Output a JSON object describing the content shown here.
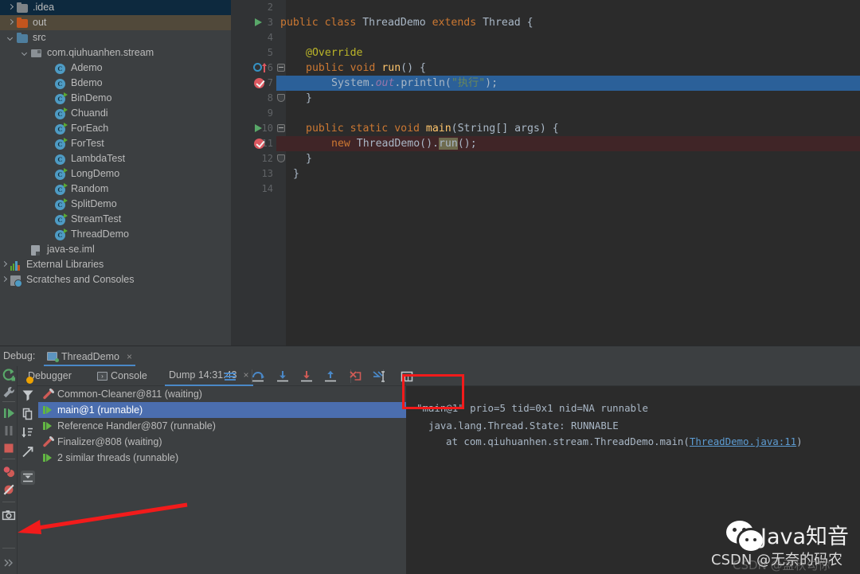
{
  "project_tree": {
    "items": [
      {
        "label": ".idea",
        "icon": "folder-gray-icon",
        "indent": 8,
        "twisty": "right",
        "state": "selected"
      },
      {
        "label": "out",
        "icon": "folder-orange-icon",
        "indent": 8,
        "twisty": "right",
        "state": "hover"
      },
      {
        "label": "src",
        "icon": "folder-blue-icon",
        "indent": 8,
        "twisty": "down",
        "state": "none"
      },
      {
        "label": "com.qiuhuanhen.stream",
        "icon": "package-icon",
        "indent": 26,
        "twisty": "down",
        "state": "none"
      },
      {
        "label": "Ademo",
        "icon": "java-class-icon",
        "indent": 56,
        "twisty": "none",
        "state": "none"
      },
      {
        "label": "Bdemo",
        "icon": "java-class-icon",
        "indent": 56,
        "twisty": "none",
        "state": "none"
      },
      {
        "label": "BinDemo",
        "icon": "java-class-runnable-icon",
        "indent": 56,
        "twisty": "none",
        "state": "none"
      },
      {
        "label": "Chuandi",
        "icon": "java-class-runnable-icon",
        "indent": 56,
        "twisty": "none",
        "state": "none"
      },
      {
        "label": "ForEach",
        "icon": "java-class-runnable-icon",
        "indent": 56,
        "twisty": "none",
        "state": "none"
      },
      {
        "label": "ForTest",
        "icon": "java-class-runnable-icon",
        "indent": 56,
        "twisty": "none",
        "state": "none"
      },
      {
        "label": "LambdaTest",
        "icon": "java-class-icon",
        "indent": 56,
        "twisty": "none",
        "state": "none"
      },
      {
        "label": "LongDemo",
        "icon": "java-class-runnable-icon",
        "indent": 56,
        "twisty": "none",
        "state": "none"
      },
      {
        "label": "Random",
        "icon": "java-class-runnable-icon",
        "indent": 56,
        "twisty": "none",
        "state": "none"
      },
      {
        "label": "SplitDemo",
        "icon": "java-class-runnable-icon",
        "indent": 56,
        "twisty": "none",
        "state": "none"
      },
      {
        "label": "StreamTest",
        "icon": "java-class-runnable-icon",
        "indent": 56,
        "twisty": "none",
        "state": "none"
      },
      {
        "label": "ThreadDemo",
        "icon": "java-class-runnable-icon",
        "indent": 56,
        "twisty": "none",
        "state": "none"
      },
      {
        "label": "java-se.iml",
        "icon": "iml-file-icon",
        "indent": 26,
        "twisty": "none",
        "state": "none"
      },
      {
        "label": "External Libraries",
        "icon": "external-libraries-icon",
        "indent": 0,
        "twisty": "right",
        "state": "none"
      },
      {
        "label": "Scratches and Consoles",
        "icon": "scratches-icon",
        "indent": 0,
        "twisty": "right",
        "state": "none"
      }
    ]
  },
  "editor": {
    "lines": [
      {
        "num": "2",
        "text": ""
      },
      {
        "num": "3",
        "text": "public class ThreadDemo extends Thread {"
      },
      {
        "num": "4",
        "text": ""
      },
      {
        "num": "5",
        "text": "    @Override"
      },
      {
        "num": "6",
        "text": "    public void run() {"
      },
      {
        "num": "7",
        "text": "        System.out.println(\"执行\");"
      },
      {
        "num": "8",
        "text": "    }"
      },
      {
        "num": "9",
        "text": ""
      },
      {
        "num": "10",
        "text": "    public static void main(String[] args) {"
      },
      {
        "num": "11",
        "text": "        new ThreadDemo().run();"
      },
      {
        "num": "12",
        "text": "    }"
      },
      {
        "num": "13",
        "text": "}"
      },
      {
        "num": "14",
        "text": ""
      }
    ],
    "tokens": {
      "l3_kw1": "public",
      "l3_kw2": "class",
      "l3_name": " ThreadDemo ",
      "l3_kw3": "extends",
      "l3_rest": " Thread {",
      "l5_annotation": "@Override",
      "l6_kw1": "public",
      "l6_kw2": "void",
      "l6_mth": "run",
      "l6_rest": "() {",
      "l7_sys": "System.",
      "l7_out": "out",
      "l7_println": ".println(",
      "l7_str": "\"执行\"",
      "l7_end": ");",
      "l8_brace": "}",
      "l10_kw1": "public",
      "l10_kw2": "static",
      "l10_kw3": "void",
      "l10_mth": "main",
      "l10_rest": "(String[] args) {",
      "l11_kw": "new",
      "l11_cls": " ThreadDemo().",
      "l11_run": "run",
      "l11_end": "();",
      "l12_brace": "}",
      "l13_brace": "}"
    },
    "colors": {
      "background": "#2B2B2B",
      "gutter": "#313335",
      "selection_blue": "#2B6099",
      "breakpoint_red": "#402527",
      "keyword": "#CC7832",
      "string": "#6A8759",
      "annotation": "#BBB529",
      "field": "#9876AA",
      "method": "#FFC66D",
      "text": "#A9B7C6"
    }
  },
  "debug": {
    "label": "Debug:",
    "run_config": "ThreadDemo",
    "close_glyph": "×",
    "tabs": [
      {
        "label": "Debugger",
        "active": false,
        "icon": "debugger-warning-icon"
      },
      {
        "label": "Console",
        "active": false,
        "icon": "console-icon"
      },
      {
        "label": "Dump 14:31:43",
        "active": true,
        "icon": "none"
      }
    ],
    "left_toolbar": [
      {
        "name": "rerun-icon",
        "tip": "Rerun"
      },
      {
        "name": "settings-wrench-icon",
        "tip": "Edit Configuration"
      },
      {
        "name": "resume-program-icon",
        "tip": "Resume Program"
      },
      {
        "name": "pause-program-icon",
        "tip": "Pause Program"
      },
      {
        "name": "stop-icon",
        "tip": "Stop"
      },
      {
        "name": "view-breakpoints-icon",
        "tip": "View Breakpoints"
      },
      {
        "name": "mute-breakpoints-icon",
        "tip": "Mute Breakpoints"
      },
      {
        "name": "thread-dump-camera-icon",
        "tip": "Get Thread Dump"
      },
      {
        "name": "overflow-icon",
        "tip": "More"
      }
    ],
    "step_toolbar": [
      {
        "name": "show-execution-point-icon"
      },
      {
        "name": "step-over-icon"
      },
      {
        "name": "step-into-icon"
      },
      {
        "name": "force-step-into-icon"
      },
      {
        "name": "step-out-icon"
      },
      {
        "name": "drop-frame-icon"
      },
      {
        "name": "run-to-cursor-icon"
      },
      {
        "name": "evaluate-expression-icon"
      }
    ],
    "thread_side_buttons": [
      {
        "name": "filter-icon"
      },
      {
        "name": "copy-icon"
      },
      {
        "name": "sort-icon"
      },
      {
        "name": "export-icon"
      },
      {
        "name": "collapse-expand-icon"
      }
    ],
    "threads": [
      {
        "label": "Common-Cleaner@811 (waiting)",
        "state": "waiting",
        "selected": false
      },
      {
        "label": "main@1 (runnable)",
        "state": "runnable",
        "selected": true
      },
      {
        "label": "Reference Handler@807 (runnable)",
        "state": "runnable",
        "selected": false
      },
      {
        "label": "Finalizer@808 (waiting)",
        "state": "waiting",
        "selected": false
      },
      {
        "label": "2 similar threads (runnable)",
        "state": "runnable",
        "selected": false
      }
    ],
    "stack_trace": {
      "header_thread": "\"main@1\"",
      "header_rest": " prio=5 tid=0x1 nid=NA runnable",
      "state_line": "java.lang.Thread.State: RUNNABLE",
      "frame_prefix": "at com.qiuhuanhen.stream.ThreadDemo.main(",
      "frame_link": "ThreadDemo.java:11",
      "frame_suffix": ")"
    }
  },
  "annotations": {
    "red_rect_target": "\"main@1\"",
    "red_arrow_target": "thread-dump-camera-icon",
    "accent_red": "#F21B1B"
  },
  "watermark": {
    "title": "Java知音",
    "subtitle": "CSDN @无奈的码农",
    "ghost": "CSDN @盂秋勾你"
  }
}
